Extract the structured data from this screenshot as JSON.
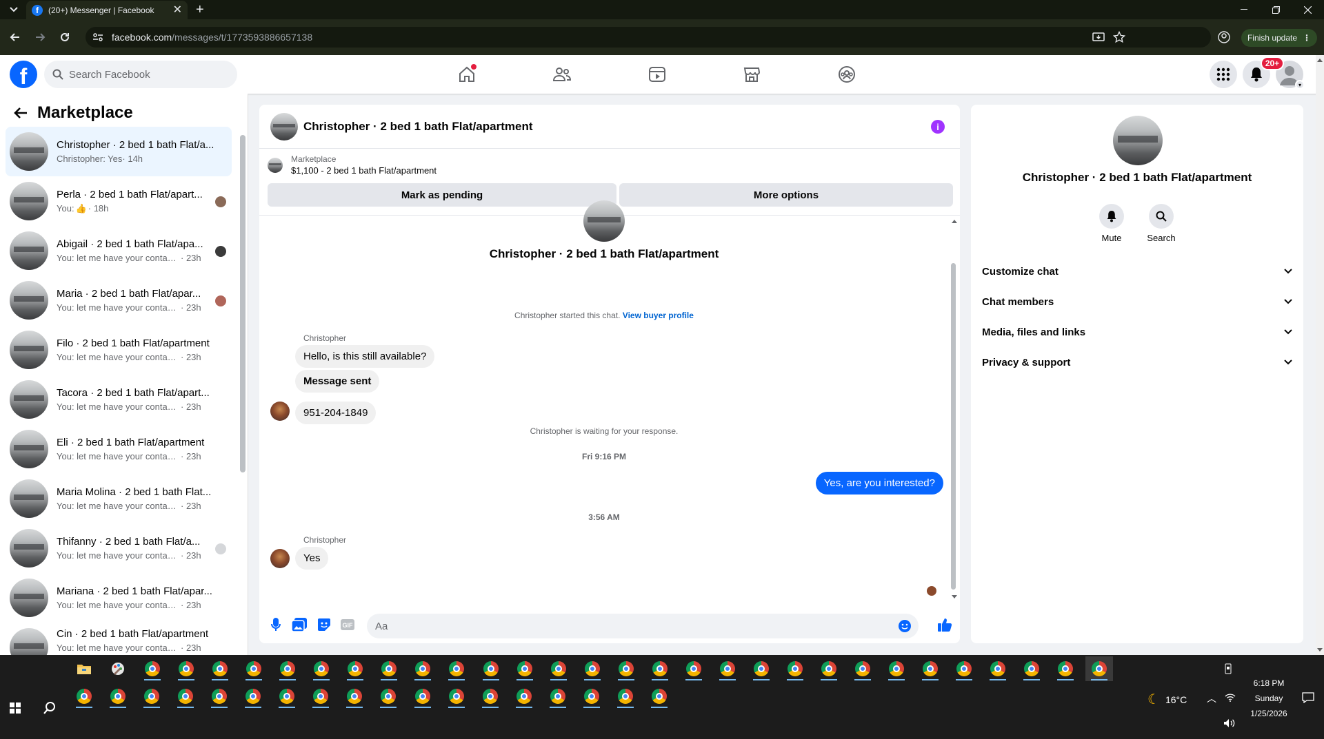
{
  "browser": {
    "tab_title": "(20+) Messenger | Facebook",
    "url_domain": "facebook.com",
    "url_path": "/messages/t/1773593886657138",
    "finish_update": "Finish update"
  },
  "fb_header": {
    "search_placeholder": "Search Facebook",
    "notification_badge": "20+"
  },
  "sidebar": {
    "title": "Marketplace",
    "conversations": [
      {
        "name": "Christopher · 2 bed 1 bath Flat/a...",
        "preview": "Christopher: Yes",
        "time": "· 14h"
      },
      {
        "name": "Perla · 2 bed 1 bath Flat/apart...",
        "preview": "You:",
        "time": "· 18h"
      },
      {
        "name": "Abigail · 2 bed 1 bath Flat/apa...",
        "preview": "You: let me have your contact n...",
        "time": "· 23h"
      },
      {
        "name": "Maria · 2 bed 1 bath Flat/apar...",
        "preview": "You: let me have your contact n...",
        "time": "· 23h"
      },
      {
        "name": "Filo · 2 bed 1 bath Flat/apartment",
        "preview": "You: let me have your contact nu...",
        "time": "· 23h"
      },
      {
        "name": "Tacora · 2 bed 1 bath Flat/apart...",
        "preview": "You: let me have your contact nu...",
        "time": "· 23h"
      },
      {
        "name": "Eli · 2 bed 1 bath Flat/apartment",
        "preview": "You: let me have your contact nu...",
        "time": "· 23h"
      },
      {
        "name": "Maria Molina · 2 bed 1 bath Flat...",
        "preview": "You: let me have your contact nu...",
        "time": "· 23h"
      },
      {
        "name": "Thifanny · 2 bed 1 bath Flat/a...",
        "preview": "You: let me have your contact n...",
        "time": "· 23h"
      },
      {
        "name": "Mariana · 2 bed 1 bath Flat/apar...",
        "preview": "You: let me have your contact nu...",
        "time": "· 23h"
      },
      {
        "name": "Cin · 2 bed 1 bath Flat/apartment",
        "preview": "You: let me have your contact nu...",
        "time": "· 23h"
      }
    ]
  },
  "chat": {
    "header_name": "Christopher · 2 bed 1 bath Flat/apartment",
    "marketplace_label": "Marketplace",
    "listing": "$1,100 - 2 bed 1 bath Flat/apartment",
    "mark_pending": "Mark as pending",
    "more_options": "More options",
    "intro_name": "Christopher · 2 bed 1 bath Flat/apartment",
    "started_text": "Christopher started this chat.",
    "view_buyer": "View buyer profile",
    "sender1": "Christopher",
    "msg1": "Hello, is this still available?",
    "msg2": "Message sent",
    "msg3": "951-204-1849",
    "waiting": "Christopher is waiting for your response.",
    "time1": "Fri 9:16 PM",
    "msg_out": "Yes, are you interested?",
    "time2": "3:56 AM",
    "sender2": "Christopher",
    "msg4": "Yes",
    "composer_placeholder": "Aa"
  },
  "details": {
    "name": "Christopher · 2 bed 1 bath Flat/apartment",
    "mute": "Mute",
    "search": "Search",
    "sections": [
      "Customize chat",
      "Chat members",
      "Media, files and links",
      "Privacy & support"
    ]
  },
  "taskbar": {
    "weather": "16°C",
    "time": "6:18 PM",
    "day": "Sunday",
    "date": "1/25/2026"
  }
}
